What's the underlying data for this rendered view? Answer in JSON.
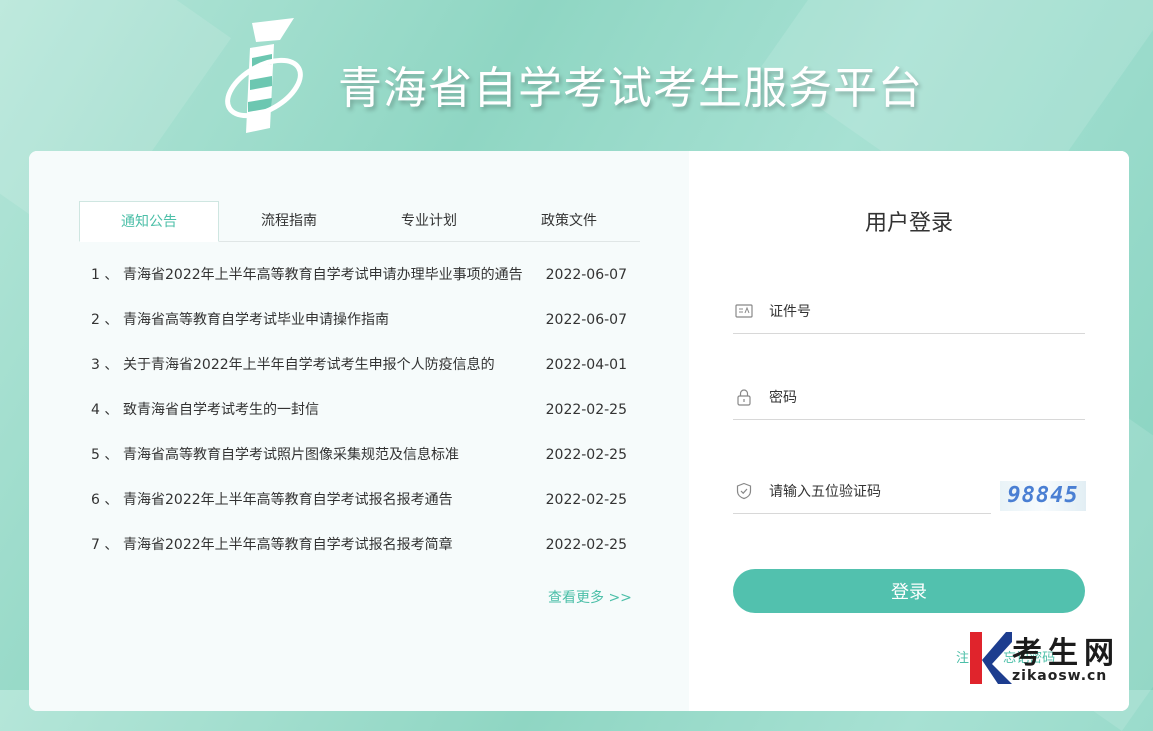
{
  "header": {
    "title": "青海省自学考试考生服务平台"
  },
  "tabs": [
    {
      "label": "通知公告",
      "active": true
    },
    {
      "label": "流程指南",
      "active": false
    },
    {
      "label": "专业计划",
      "active": false
    },
    {
      "label": "政策文件",
      "active": false
    }
  ],
  "news": [
    {
      "idx": "1 、",
      "title": "青海省2022年上半年高等教育自学考试申请办理毕业事项的通告",
      "date": "2022-06-07"
    },
    {
      "idx": "2 、",
      "title": "青海省高等教育自学考试毕业申请操作指南",
      "date": "2022-06-07"
    },
    {
      "idx": "3 、",
      "title": "关于青海省2022年上半年自学考试考生申报个人防疫信息的",
      "date": "2022-04-01"
    },
    {
      "idx": "4 、",
      "title": "致青海省自学考试考生的一封信",
      "date": "2022-02-25"
    },
    {
      "idx": "5 、",
      "title": "青海省高等教育自学考试照片图像采集规范及信息标准",
      "date": "2022-02-25"
    },
    {
      "idx": "6 、",
      "title": "青海省2022年上半年高等教育自学考试报名报考通告",
      "date": "2022-02-25"
    },
    {
      "idx": "7 、",
      "title": "青海省2022年上半年高等教育自学考试报名报考简章",
      "date": "2022-02-25"
    }
  ],
  "more_link": "查看更多 >>",
  "login": {
    "title": "用户登录",
    "id_placeholder": "证件号",
    "password_placeholder": "密码",
    "captcha_placeholder": "请输入五位验证码",
    "captcha_value": "98845",
    "submit_label": "登录",
    "register_label": "注",
    "forgot_label": "忘记密码"
  },
  "watermark": {
    "brand": "考生网",
    "url": "zikaosw.cn",
    "letter": "K"
  },
  "colors": {
    "accent": "#52c1ae",
    "link": "#4cbfa8",
    "watermark_red": "#e0242c",
    "watermark_blue": "#1d3d8f"
  },
  "icons": [
    "logo-mark",
    "id-card-icon",
    "lock-icon",
    "shield-icon",
    "watermark-k-logo"
  ]
}
